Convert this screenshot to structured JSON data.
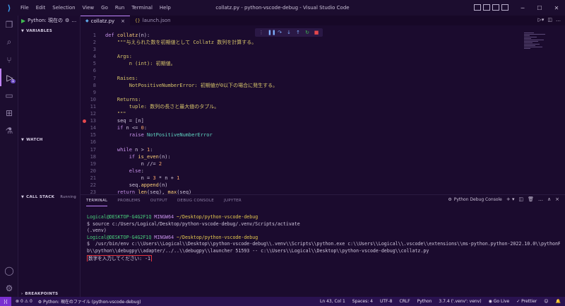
{
  "window": {
    "title": "collatz.py - python-vscode-debug - Visual Studio Code",
    "menu": [
      "File",
      "Edit",
      "Selection",
      "View",
      "Go",
      "Run",
      "Terminal",
      "Help"
    ]
  },
  "sidebar": {
    "run_config": "Python: 現在の",
    "sections": {
      "variables": "VARIABLES",
      "watch": "WATCH",
      "call_stack": "CALL STACK",
      "call_stack_state": "Running",
      "breakpoints": "BREAKPOINTS"
    },
    "debug_badge": "1"
  },
  "editor": {
    "tabs": [
      {
        "label": "collatz.py",
        "active": true
      },
      {
        "label": "launch.json",
        "active": false
      }
    ],
    "lines": [
      {
        "n": "1",
        "parts": [
          [
            "kw",
            "def "
          ],
          [
            "fn",
            "collatz"
          ],
          [
            "txt",
            "(n):"
          ]
        ]
      },
      {
        "n": "2",
        "parts": [
          [
            "doc",
            "    \"\"\"与えられた数を初期値として Collatz 数列を計算する。"
          ]
        ]
      },
      {
        "n": "3",
        "parts": []
      },
      {
        "n": "4",
        "parts": [
          [
            "doc",
            "    Args:"
          ]
        ]
      },
      {
        "n": "5",
        "parts": [
          [
            "doc",
            "        n (int): 初期値。"
          ]
        ]
      },
      {
        "n": "6",
        "parts": []
      },
      {
        "n": "7",
        "parts": [
          [
            "doc",
            "    Raises:"
          ]
        ]
      },
      {
        "n": "8",
        "parts": [
          [
            "doc",
            "        NotPositiveNumberError: 初期値が0以下の場合に発生する。"
          ]
        ]
      },
      {
        "n": "9",
        "parts": []
      },
      {
        "n": "10",
        "parts": [
          [
            "doc",
            "    Returns:"
          ]
        ]
      },
      {
        "n": "11",
        "parts": [
          [
            "doc",
            "        tuple: 数列の長さと最大値のタプル。"
          ]
        ]
      },
      {
        "n": "12",
        "parts": [
          [
            "doc",
            "    \"\"\""
          ]
        ]
      },
      {
        "n": "13",
        "bp": true,
        "parts": [
          [
            "txt",
            "    seq = [n]"
          ]
        ]
      },
      {
        "n": "14",
        "parts": [
          [
            "kw",
            "    if "
          ],
          [
            "txt",
            "n <= "
          ],
          [
            "num",
            "0"
          ],
          [
            "txt",
            ":"
          ]
        ]
      },
      {
        "n": "15",
        "parts": [
          [
            "kw",
            "        raise "
          ],
          [
            "cls",
            "NotPositiveNumberError"
          ]
        ]
      },
      {
        "n": "16",
        "parts": []
      },
      {
        "n": "17",
        "parts": [
          [
            "kw",
            "    while "
          ],
          [
            "txt",
            "n > "
          ],
          [
            "num",
            "1"
          ],
          [
            "txt",
            ":"
          ]
        ]
      },
      {
        "n": "18",
        "parts": [
          [
            "kw",
            "        if "
          ],
          [
            "fn",
            "is_even"
          ],
          [
            "txt",
            "(n):"
          ]
        ]
      },
      {
        "n": "19",
        "parts": [
          [
            "txt",
            "            n //= "
          ],
          [
            "num",
            "2"
          ]
        ]
      },
      {
        "n": "20",
        "parts": [
          [
            "kw",
            "        else"
          ],
          [
            "txt",
            ":"
          ]
        ]
      },
      {
        "n": "21",
        "parts": [
          [
            "txt",
            "            n = "
          ],
          [
            "num",
            "3"
          ],
          [
            "txt",
            " * n + "
          ],
          [
            "num",
            "1"
          ]
        ]
      },
      {
        "n": "22",
        "parts": [
          [
            "txt",
            "        seq."
          ],
          [
            "fn",
            "append"
          ],
          [
            "txt",
            "(n)"
          ]
        ]
      },
      {
        "n": "23",
        "parts": [
          [
            "kw",
            "    return "
          ],
          [
            "fn",
            "len"
          ],
          [
            "txt",
            "(seq), "
          ],
          [
            "fn",
            "max"
          ],
          [
            "txt",
            "(seq)"
          ]
        ]
      }
    ]
  },
  "panel": {
    "tabs": [
      "TERMINAL",
      "PROBLEMS",
      "OUTPUT",
      "DEBUG CONSOLE",
      "JUPYTER"
    ],
    "terminal_name": "Python Debug Console",
    "lines": [
      {
        "parts": [
          [
            "green",
            "Logical@DESKTOP-G4G2F1Q "
          ],
          [
            "purple",
            "MINGW64 "
          ],
          [
            "yellow",
            "~/Desktop/python-vscode-debug"
          ]
        ]
      },
      {
        "parts": [
          [
            "txt",
            "$ source c:/Users/Logical/Desktop/python-vscode-debug/.venv/Scripts/activate"
          ]
        ]
      },
      {
        "parts": [
          [
            "txt",
            "(.venv)"
          ]
        ]
      },
      {
        "parts": [
          [
            "green",
            "Logical@DESKTOP-G4G2F1Q "
          ],
          [
            "purple",
            "MINGW64 "
          ],
          [
            "yellow",
            "~/Desktop/python-vscode-debug"
          ]
        ]
      },
      {
        "parts": [
          [
            "txt",
            "$  /usr/bin/env c:\\\\Users\\\\Logical\\\\Desktop\\\\python-vscode-debug\\\\.venv\\\\Scripts\\\\python.exe c:\\\\Users\\\\Logical\\\\.vscode\\\\extensions\\\\ms-python.python-2022.10.0\\\\pythonFiles\\\\li"
          ]
        ]
      },
      {
        "parts": [
          [
            "txt",
            "b\\\\python\\\\debugpy\\\\adapter/../..\\\\debugpy\\\\launcher 51593 -- c:\\\\Users\\\\Logical\\\\Desktop\\\\python-vscode-debug\\\\collatz.py"
          ]
        ]
      }
    ],
    "prompt": "数字を入力してください: -1"
  },
  "status": {
    "errors": "0",
    "warnings": "0",
    "debug_config": "Python: 現在のファイル (python-vscode-debug)",
    "position": "Ln 43, Col 1",
    "spaces": "Spaces: 4",
    "encoding": "UTF-8",
    "eol": "CRLF",
    "language": "Python",
    "interpreter": "3.7.4 ('.venv': venv)",
    "golive": "Go Live",
    "prettier": "Prettier"
  },
  "colors": {
    "background": "#1b0b2e",
    "accent": "#c084fc",
    "statusbar": "#2a1250",
    "breakpoint": "#e5484d"
  }
}
